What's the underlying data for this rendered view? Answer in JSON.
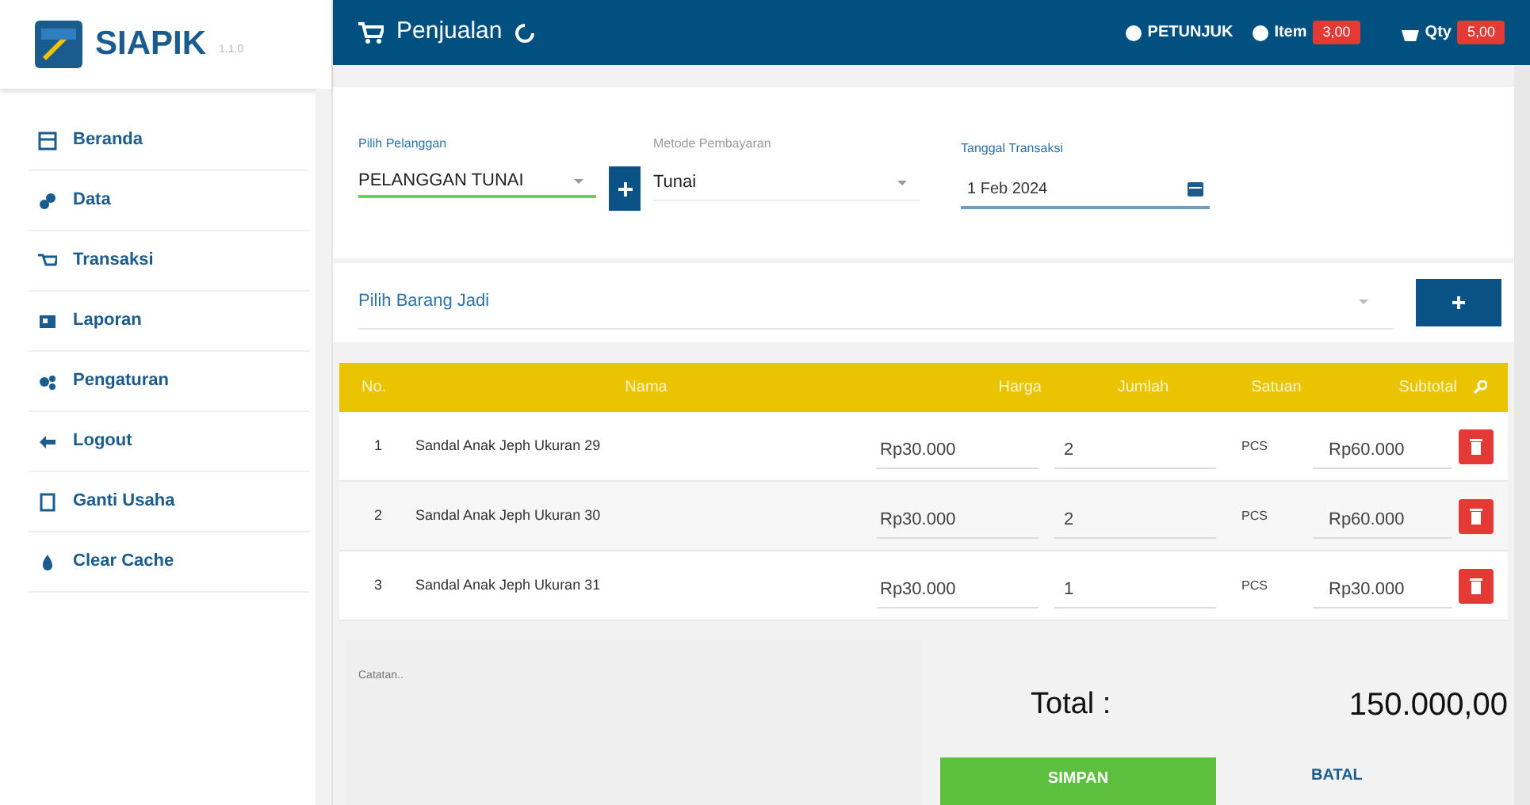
{
  "app": {
    "name": "SIAPIK",
    "version": "1.1.0"
  },
  "sidebar": {
    "items": [
      {
        "label": "Beranda"
      },
      {
        "label": "Data"
      },
      {
        "label": "Transaksi"
      },
      {
        "label": "Laporan"
      },
      {
        "label": "Pengaturan"
      },
      {
        "label": "Logout"
      },
      {
        "label": "Ganti Usaha"
      },
      {
        "label": "Clear Cache"
      }
    ]
  },
  "header": {
    "title": "Penjualan",
    "help": "PETUNJUK",
    "item_label": "Item",
    "item_count": "3,00",
    "qty_label": "Qty",
    "qty_count": "5,00"
  },
  "form": {
    "customer": {
      "label": "Pilih Pelanggan",
      "value": "PELANGGAN TUNAI"
    },
    "payment": {
      "label": "Metode Pembayaran",
      "value": "Tunai"
    },
    "date": {
      "label": "Tanggal Transaksi",
      "value": "1 Feb 2024"
    }
  },
  "item_picker": {
    "placeholder": "Pilih Barang Jadi"
  },
  "table": {
    "columns": [
      "No.",
      "Nama",
      "Harga",
      "Jumlah",
      "Satuan",
      "Subtotal"
    ],
    "rows": [
      {
        "no": "1",
        "name": "Sandal Anak Jeph Ukuran 29",
        "price": "Rp30.000",
        "qty": "2",
        "unit": "PCS",
        "subtotal": "Rp60.000"
      },
      {
        "no": "2",
        "name": "Sandal Anak Jeph Ukuran 30",
        "price": "Rp30.000",
        "qty": "2",
        "unit": "PCS",
        "subtotal": "Rp60.000"
      },
      {
        "no": "3",
        "name": "Sandal Anak Jeph Ukuran 31",
        "price": "Rp30.000",
        "qty": "1",
        "unit": "PCS",
        "subtotal": "Rp30.000"
      }
    ]
  },
  "notes": {
    "placeholder": "Catatan.."
  },
  "total": {
    "label": "Total :",
    "value": "150.000,00"
  },
  "buttons": {
    "save": "SIMPAN",
    "cancel": "BATAL"
  }
}
